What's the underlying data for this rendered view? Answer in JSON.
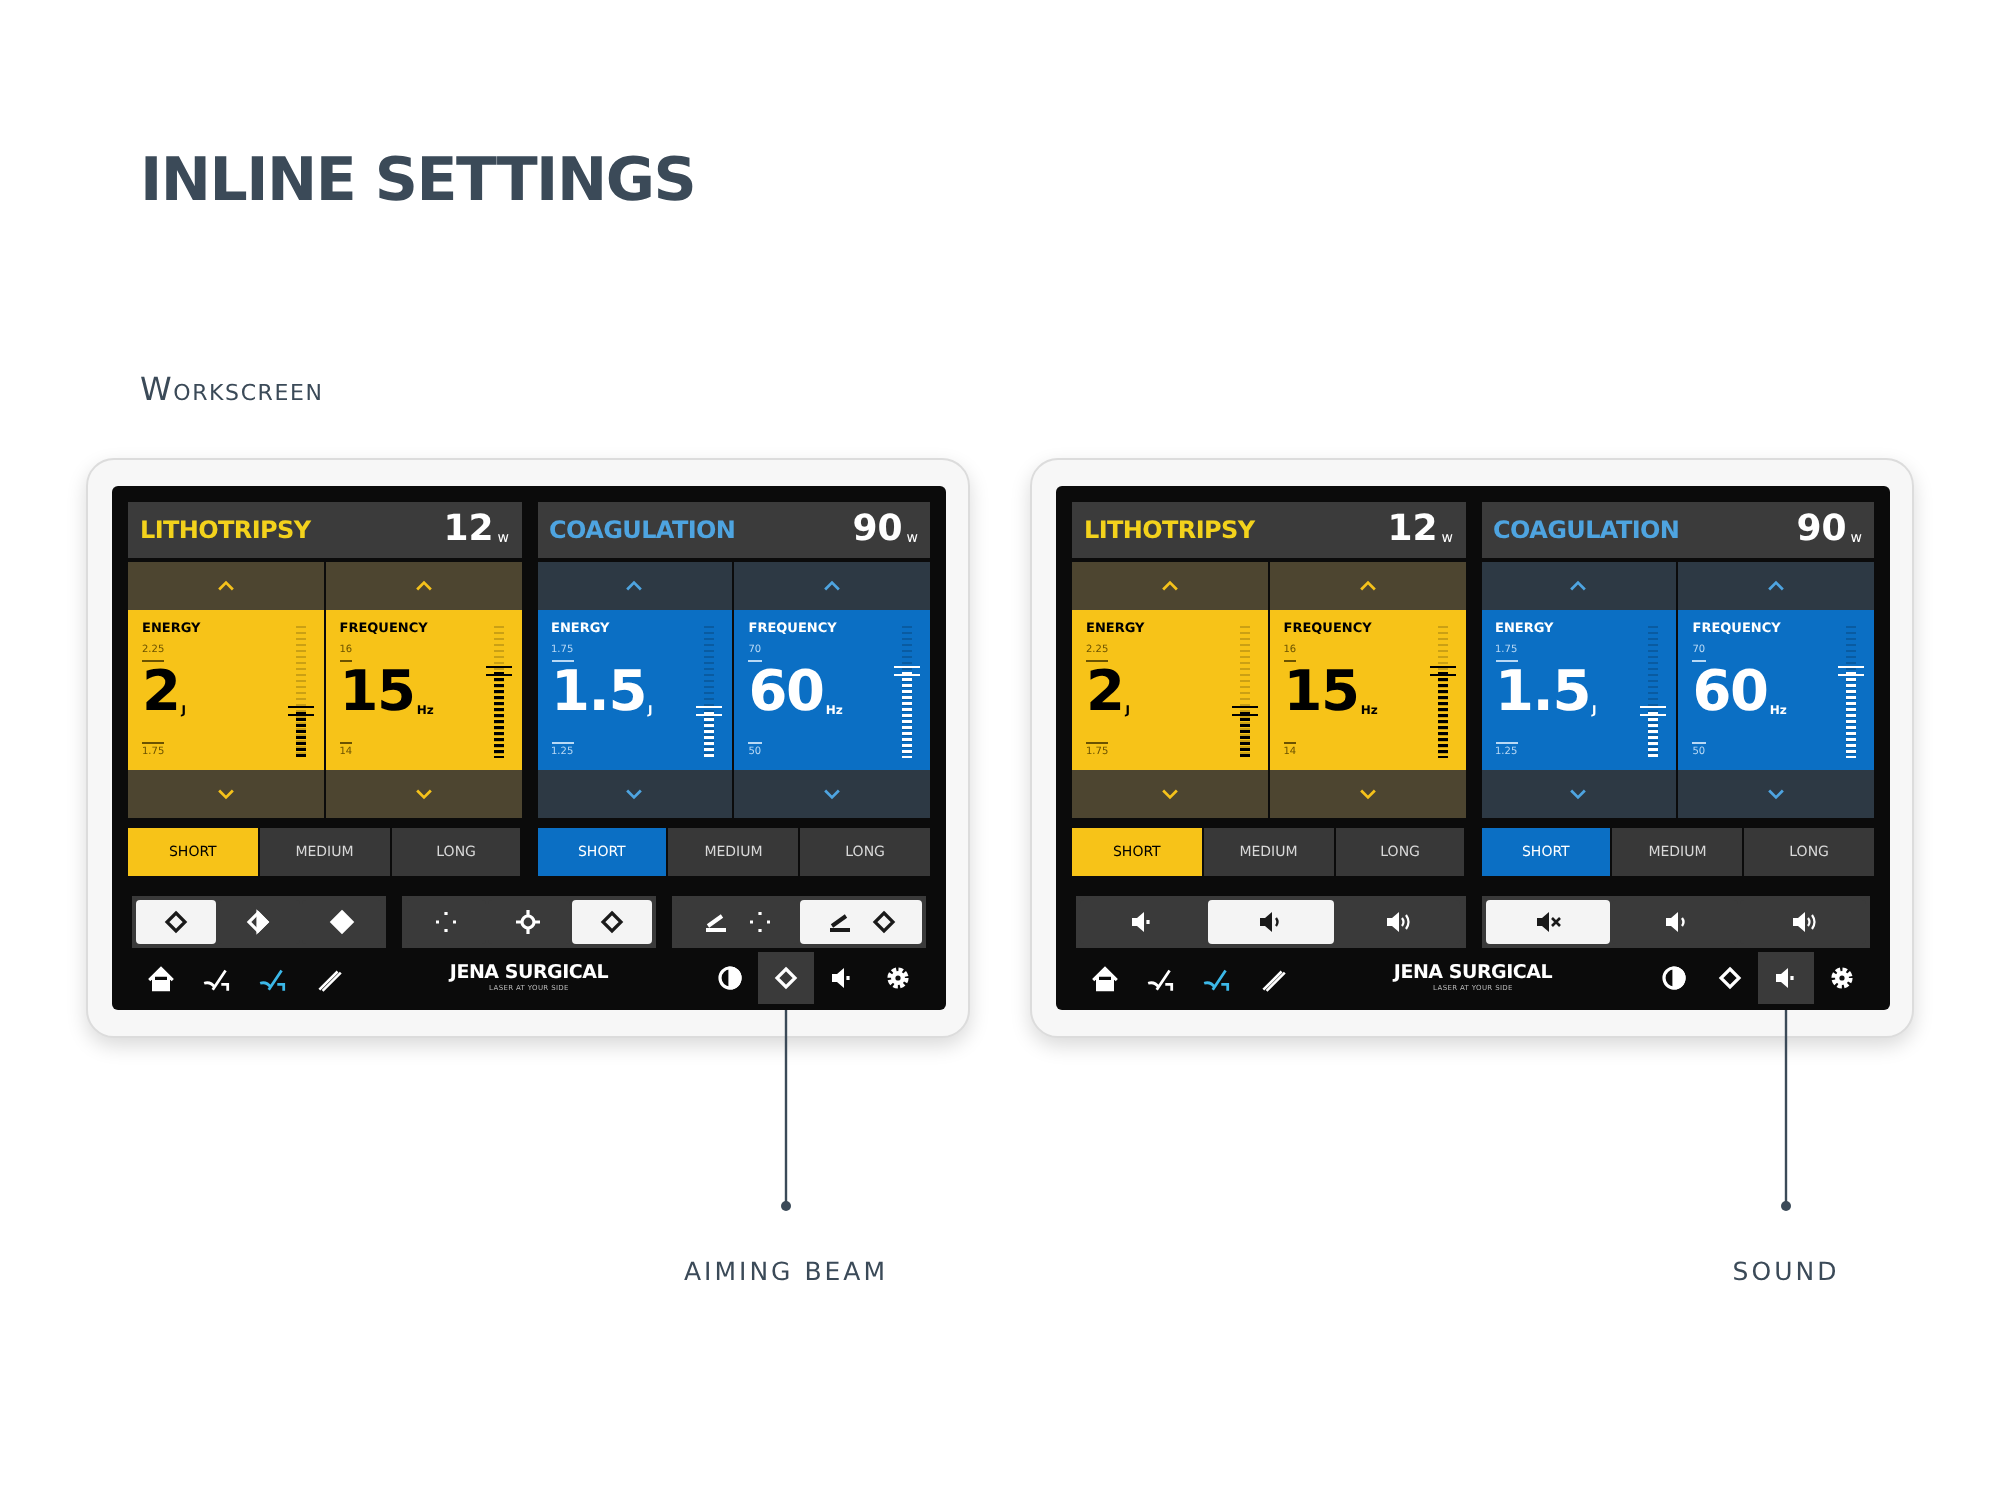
{
  "title": "INLINE SETTINGS",
  "subtitle": "Workscreen",
  "devices": [
    {
      "panels": [
        {
          "mode": "LITHOTRIPSY",
          "kind": "yellow",
          "power": "12",
          "power_unit": "w",
          "params": [
            {
              "label": "ENERGY",
              "upper": "2.25",
              "value": "2",
              "unit": "J",
              "lower": "1.75",
              "level": 0.35
            },
            {
              "label": "FREQUENCY",
              "upper": "16",
              "value": "15",
              "unit": "Hz",
              "lower": "14",
              "level": 0.65
            }
          ],
          "pulses": [
            {
              "label": "SHORT",
              "selected": true
            },
            {
              "label": "MEDIUM",
              "selected": false
            },
            {
              "label": "LONG",
              "selected": false
            }
          ]
        },
        {
          "mode": "COAGULATION",
          "kind": "blue",
          "power": "90",
          "power_unit": "w",
          "params": [
            {
              "label": "ENERGY",
              "upper": "1.75",
              "value": "1.5",
              "unit": "J",
              "lower": "1.25",
              "level": 0.35
            },
            {
              "label": "FREQUENCY",
              "upper": "70",
              "value": "60",
              "unit": "Hz",
              "lower": "50",
              "level": 0.65
            }
          ],
          "pulses": [
            {
              "label": "SHORT",
              "selected": true
            },
            {
              "label": "MEDIUM",
              "selected": false
            },
            {
              "label": "LONG",
              "selected": false
            }
          ]
        }
      ],
      "controls": [
        [
          {
            "kind": "diamond",
            "selected": true
          },
          {
            "kind": "half-diamond",
            "selected": false
          },
          {
            "kind": "solid-diamond",
            "selected": false
          }
        ],
        [
          {
            "kind": "dots",
            "selected": false
          },
          {
            "kind": "crosshair",
            "selected": false
          },
          {
            "kind": "diamond",
            "selected": true
          }
        ],
        [
          {
            "kind": "pedal-dots",
            "selected": false
          },
          {
            "kind": "pedal-diamond",
            "selected": true
          }
        ]
      ],
      "nav": [
        {
          "kind": "home",
          "selected": false,
          "active": false
        },
        {
          "kind": "fiber",
          "selected": false,
          "active": false
        },
        {
          "kind": "fiber",
          "selected": false,
          "active": true
        },
        {
          "kind": "pen",
          "selected": false,
          "active": false
        },
        {
          "kind": "logo"
        },
        {
          "kind": "contrast",
          "selected": false,
          "active": false
        },
        {
          "kind": "diamond",
          "selected": true,
          "active": false
        },
        {
          "kind": "speaker",
          "selected": false,
          "active": false
        },
        {
          "kind": "gear",
          "selected": false,
          "active": false
        }
      ],
      "logo": {
        "name": "JENA SURGICAL",
        "tagline": "LASER AT YOUR SIDE"
      },
      "callout": "AIMING BEAM"
    },
    {
      "panels": [
        {
          "mode": "LITHOTRIPSY",
          "kind": "yellow",
          "power": "12",
          "power_unit": "w",
          "params": [
            {
              "label": "ENERGY",
              "upper": "2.25",
              "value": "2",
              "unit": "J",
              "lower": "1.75",
              "level": 0.35
            },
            {
              "label": "FREQUENCY",
              "upper": "16",
              "value": "15",
              "unit": "Hz",
              "lower": "14",
              "level": 0.65
            }
          ],
          "pulses": [
            {
              "label": "SHORT",
              "selected": true
            },
            {
              "label": "MEDIUM",
              "selected": false
            },
            {
              "label": "LONG",
              "selected": false
            }
          ]
        },
        {
          "mode": "COAGULATION",
          "kind": "blue",
          "power": "90",
          "power_unit": "w",
          "params": [
            {
              "label": "ENERGY",
              "upper": "1.75",
              "value": "1.5",
              "unit": "J",
              "lower": "1.25",
              "level": 0.35
            },
            {
              "label": "FREQUENCY",
              "upper": "70",
              "value": "60",
              "unit": "Hz",
              "lower": "50",
              "level": 0.65
            }
          ],
          "pulses": [
            {
              "label": "SHORT",
              "selected": true
            },
            {
              "label": "MEDIUM",
              "selected": false
            },
            {
              "label": "LONG",
              "selected": false
            }
          ]
        }
      ],
      "controls": [
        [
          {
            "kind": "speaker-low",
            "selected": false
          },
          {
            "kind": "speaker-mid",
            "selected": true
          },
          {
            "kind": "speaker-high",
            "selected": false
          }
        ],
        [
          {
            "kind": "speaker-mute",
            "selected": true
          },
          {
            "kind": "speaker-mid",
            "selected": false
          },
          {
            "kind": "speaker-high",
            "selected": false
          }
        ]
      ],
      "nav": [
        {
          "kind": "home",
          "selected": false,
          "active": false
        },
        {
          "kind": "fiber",
          "selected": false,
          "active": false
        },
        {
          "kind": "fiber",
          "selected": false,
          "active": true
        },
        {
          "kind": "pen",
          "selected": false,
          "active": false
        },
        {
          "kind": "logo"
        },
        {
          "kind": "contrast",
          "selected": false,
          "active": false
        },
        {
          "kind": "diamond",
          "selected": false,
          "active": false
        },
        {
          "kind": "speaker",
          "selected": true,
          "active": false
        },
        {
          "kind": "gear",
          "selected": false,
          "active": false
        }
      ],
      "logo": {
        "name": "JENA SURGICAL",
        "tagline": "LASER AT YOUR SIDE"
      },
      "callout": "SOUND"
    }
  ]
}
